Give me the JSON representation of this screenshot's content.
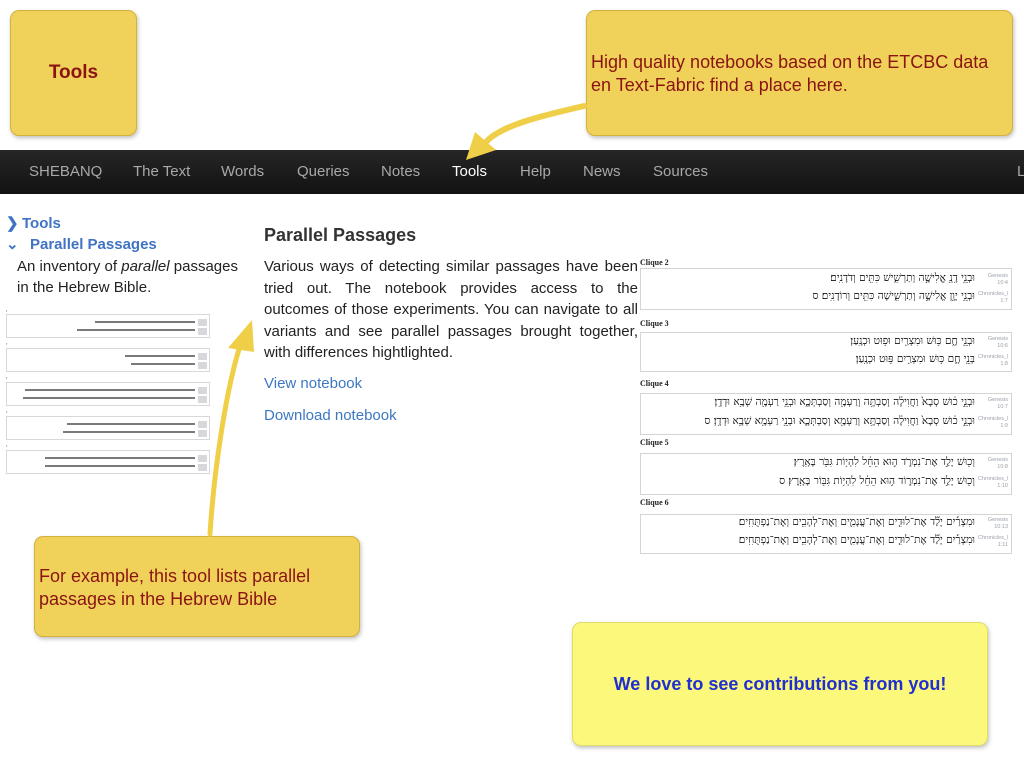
{
  "notes": {
    "tools": "Tools",
    "notebooks": "High quality notebooks based on the ETCBC data en Text-Fabric find a place here.",
    "example": "For example, this tool lists parallel passages in the Hebrew Bible",
    "contrib": "We love to see contributions from you!"
  },
  "navbar": {
    "items": [
      "SHEBANQ",
      "The Text",
      "Words",
      "Queries",
      "Notes",
      "Tools",
      "Help",
      "News",
      "Sources",
      "L"
    ],
    "active": "Tools"
  },
  "sidebar": {
    "root": "Tools",
    "child": "Parallel Passages",
    "desc_before": "An inventory of ",
    "desc_em": "parallel",
    "desc_after": " passages in the Hebrew Bible."
  },
  "main": {
    "title": "Parallel Passages",
    "description": "Various ways of detecting similar passages have been tried out. The notebook provides access to the outcomes of those experiments. You can navigate to all variants and see parallel passages brought together, with differences hightlighted.",
    "view_link": "View notebook",
    "download_link": "Download notebook"
  },
  "cliques": [
    {
      "label": "Clique 2",
      "lines": [
        "וּבְנֵ֥י דָֽנְ֖ אֱלִישָׁ֣ה וְתַרְשִׁ֑ישׁ כִּתִּ֖ים וְדֹדָנִֽים׃",
        "וּבְנֵ֥י יָוָ֖ן אֱלִישָׁ֣ה וְתַרְשִׁ֑ישָׁה כִּתִּ֖ים וְרוֹדָנִֽים׃ ס"
      ],
      "refs": [
        [
          "Genesis",
          "10:4"
        ],
        [
          "Chronicles_I",
          "1:7"
        ]
      ]
    },
    {
      "label": "Clique 3",
      "lines": [
        "וּבְנֵ֖י חָ֑ם כּ֥וּשׁ וּמִצְרַ֖יִם וּפ֥וּט וּכְנָֽעַן׃",
        "בְּנֵ֖י חָ֑ם כּ֥וּשׁ וּמִצְרַ֖יִם פּ֥וּט וּכְנָֽעַן׃"
      ],
      "refs": [
        [
          "Genesis",
          "10:6"
        ],
        [
          "Chronicles_I",
          "1:8"
        ]
      ]
    },
    {
      "label": "Clique 4",
      "lines": [
        "וּבְנֵ֣י כ֔וּשׁ סְבָא֙ וַחֲוִילָ֔ה וְסַבְתָּ֥ה וְרַעְמָ֖ה וְסַבְתְּכָ֑א וּבְנֵ֥י רַעְמָ֖ה שְׁבָ֥א וּדְדָֽן׃",
        "וּבְנֵ֣י כ֔וּשׁ סְבָא֙ וַחֲוִילָ֔ה וְסַבְתָּ֥א וְרַעְמָ֖א וְסַבְתְּכָ֑א וּבְנֵ֥י רַעְמָ֖א שְׁבָ֥א וּדְדָֽן׃ ס"
      ],
      "refs": [
        [
          "Genesis",
          "10:7"
        ],
        [
          "Chronicles_I",
          "1:9"
        ]
      ]
    },
    {
      "label": "Clique 5",
      "lines": [
        "וְכ֖וּשׁ יָלַ֣ד אֶת־נִמְרֹ֑ד ה֣וּא הֵחֵ֔ל לִהְי֥וֹת גִּבֹּ֖ר בָּאָֽרֶץ׃",
        "וְכ֖וּשׁ יָלַ֣ד אֶת־נִמְר֑וֹד ה֣וּא הֵחֵ֔ל לִהְי֥וֹת גִּבּ֖וֹר בָּאָֽרֶץ׃ ס"
      ],
      "refs": [
        [
          "Genesis",
          "10:8"
        ],
        [
          "Chronicles_I",
          "1:10"
        ]
      ]
    },
    {
      "label": "Clique 6",
      "lines": [
        "וּמִצְרַ֡יִם יָלַ֞ד אֶת־לוּדִ֧ים וְאֶת־עֲנָמִ֛ים וְאֶת־לְהָבִ֖ים וְאֶת־נַפְתֻּחִֽים׃",
        "וּמִצְרַ֡יִם יָלַ֞ד אֶת־לוּדִ֧ים וְאֶת־עֲנָמִ֛ים וְאֶת־לְהָבִ֖ים וְאֶת־נַפְתֻּחִֽים׃"
      ],
      "refs": [
        [
          "Genesis",
          "10:13"
        ],
        [
          "Chronicles_I",
          "1:11"
        ]
      ]
    }
  ],
  "colors": {
    "note_gold": "#f0d159",
    "note_pale": "#fbf87b",
    "note_text": "#8a1414",
    "contrib_text": "#1f2fd0",
    "navbar": "#1c1c1c",
    "link": "#3c78c2",
    "arrow": "#f0cf48",
    "highlight_yellow": "#f3ee6a",
    "highlight_green": "#9fe39a"
  }
}
